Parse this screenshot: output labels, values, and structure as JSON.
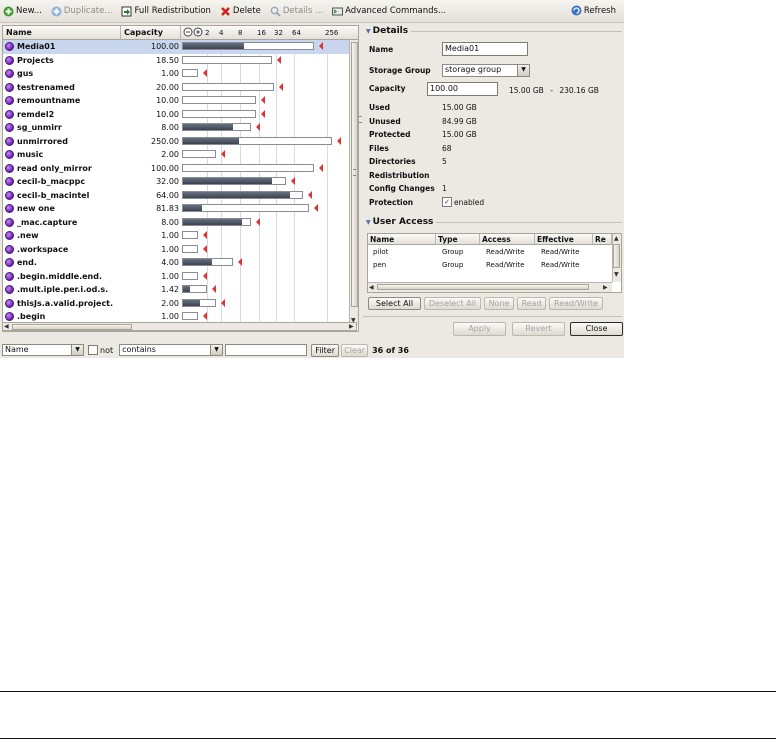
{
  "toolbar": {
    "new_label": "New...",
    "duplicate_label": "Duplicate...",
    "full_redistribution_label": "Full Redistribution",
    "delete_label": "Delete",
    "details_label": "Details ...",
    "advanced_commands_label": "Advanced Commands...",
    "refresh_label": "Refresh"
  },
  "workspace_table": {
    "headers": {
      "name": "Name",
      "capacity": "Capacity"
    },
    "scale_ticks": [
      "2",
      "4",
      "8",
      "16",
      "32",
      "64",
      "256"
    ],
    "rows": [
      {
        "name": "Media01",
        "capacity": "100.00",
        "used_fraction": 0.47,
        "selected": true
      },
      {
        "name": "Projects",
        "capacity": "18.50",
        "used_fraction": 0.0
      },
      {
        "name": "gus",
        "capacity": "1.00",
        "used_fraction": 0.0
      },
      {
        "name": "testrenamed",
        "capacity": "20.00",
        "used_fraction": 0.0
      },
      {
        "name": "remountname",
        "capacity": "10.00",
        "used_fraction": 0.0
      },
      {
        "name": "remdel2",
        "capacity": "10.00",
        "used_fraction": 0.0
      },
      {
        "name": "sg_unmirr",
        "capacity": "8.00",
        "used_fraction": 0.75
      },
      {
        "name": "unmirrored",
        "capacity": "250.00",
        "used_fraction": 0.38
      },
      {
        "name": "music",
        "capacity": "2.00",
        "used_fraction": 0.0
      },
      {
        "name": "read only_mirror",
        "capacity": "100.00",
        "used_fraction": 0.0
      },
      {
        "name": "cecil-b_macppc",
        "capacity": "32.00",
        "used_fraction": 0.88
      },
      {
        "name": "cecil-b_macintel",
        "capacity": "64.00",
        "used_fraction": 0.9
      },
      {
        "name": "new one",
        "capacity": "81.83",
        "used_fraction": 0.15
      },
      {
        "name": "_mac.capture",
        "capacity": "8.00",
        "used_fraction": 0.88
      },
      {
        "name": ".new",
        "capacity": "1.00",
        "used_fraction": 0.0
      },
      {
        "name": ".workspace",
        "capacity": "1.00",
        "used_fraction": 0.0
      },
      {
        "name": "end.",
        "capacity": "4.00",
        "used_fraction": 0.6
      },
      {
        "name": ".begin.middle.end.",
        "capacity": "1.00",
        "used_fraction": 0.0
      },
      {
        "name": ".mult.iple.per.i.od.s.",
        "capacity": "1.42",
        "used_fraction": 0.3
      },
      {
        "name": "thisJs.a.valid.project.",
        "capacity": "2.00",
        "used_fraction": 0.55
      },
      {
        "name": ".begin",
        "capacity": "1.00",
        "used_fraction": 0.0
      }
    ]
  },
  "filter": {
    "field_value": "Name",
    "not_label": "not",
    "operator_value": "contains",
    "text_value": "",
    "filter_button": "Filter",
    "clear_button": "Clear",
    "count_text": "36 of 36"
  },
  "details": {
    "section_title": "Details",
    "name_label": "Name",
    "name_value": "Media01",
    "storage_group_label": "Storage Group",
    "storage_group_value": "storage group",
    "capacity_label": "Capacity",
    "capacity_value": "100.00",
    "capacity_min": "15.00 GB",
    "capacity_sep": "-",
    "capacity_max": "230.16 GB",
    "used_label": "Used",
    "used_value": "15.00 GB",
    "unused_label": "Unused",
    "unused_value": "84.99 GB",
    "protected_label": "Protected",
    "protected_value": "15.00 GB",
    "files_label": "Files",
    "files_value": "68",
    "directories_label": "Directories",
    "directories_value": "5",
    "redistribution_label": "Redistribution",
    "redistribution_value": "",
    "config_changes_label": "Config Changes",
    "config_changes_value": "1",
    "protection_label": "Protection",
    "protection_value": "enabled"
  },
  "user_access": {
    "section_title": "User Access",
    "headers": {
      "name": "Name",
      "type": "Type",
      "access": "Access",
      "effective": "Effective",
      "re": "Re"
    },
    "rows": [
      {
        "name": "pilot",
        "type": "Group",
        "access": "Read/Write",
        "effective": "Read/Write"
      },
      {
        "name": "pen",
        "type": "Group",
        "access": "Read/Write",
        "effective": "Read/Write"
      }
    ],
    "buttons": {
      "select_all": "Select All",
      "deselect_all": "Deselect All",
      "none": "None",
      "read": "Read",
      "read_write": "Read/Write"
    }
  },
  "dialog_buttons": {
    "apply": "Apply",
    "revert": "Revert",
    "close": "Close"
  }
}
